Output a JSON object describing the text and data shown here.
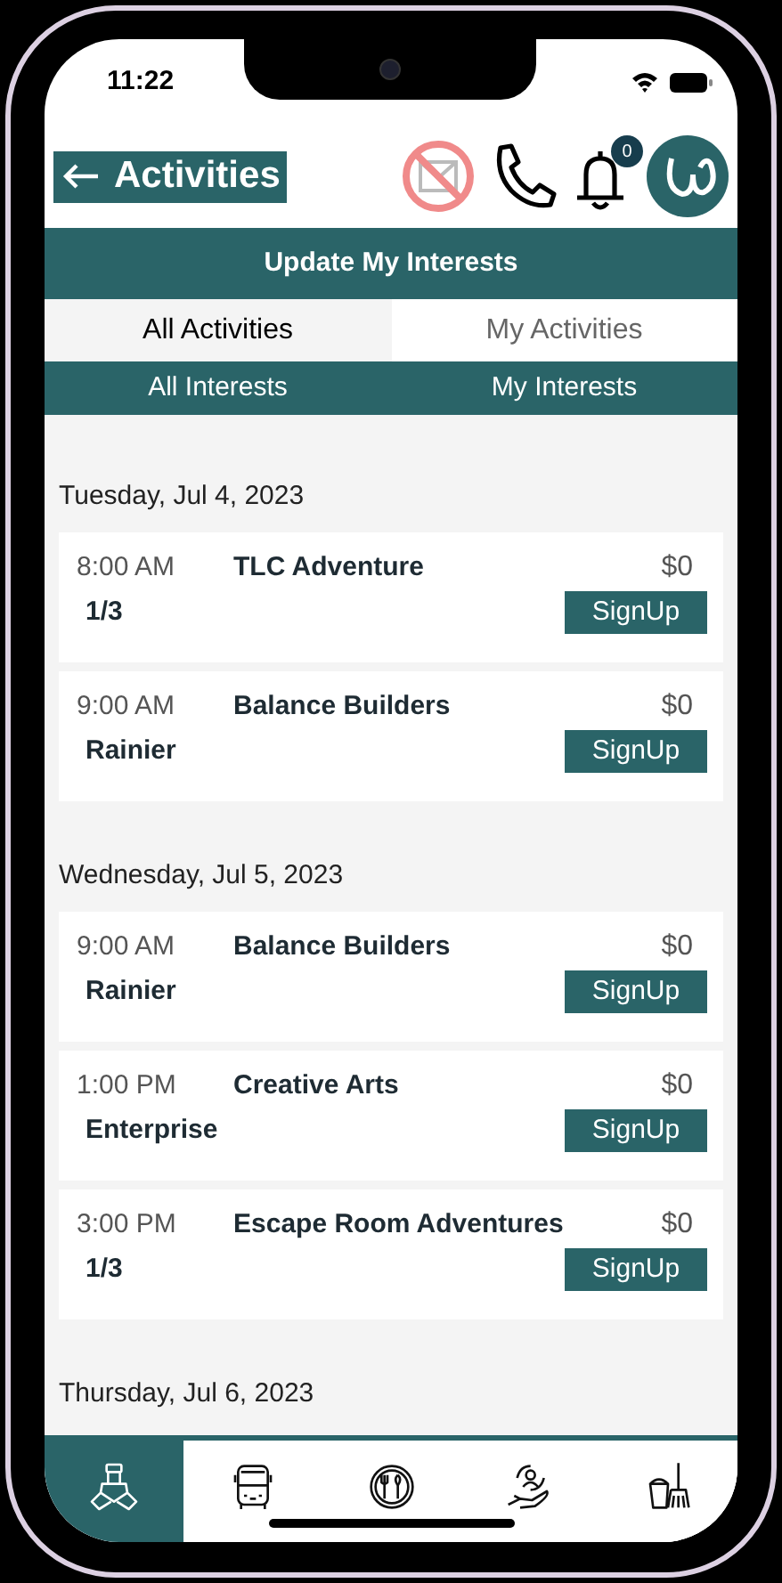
{
  "status_bar": {
    "time": "11:22"
  },
  "header": {
    "title": "Activities",
    "notification_count": "0"
  },
  "update_button": "Update My Interests",
  "tabs": [
    {
      "label": "All Activities",
      "selected": true
    },
    {
      "label": "My Activities",
      "selected": false
    }
  ],
  "interest_filters": [
    "All Interests",
    "My Interests"
  ],
  "days": [
    {
      "date": "Tuesday, Jul 4, 2023",
      "activities": [
        {
          "time": "8:00 AM",
          "title": "TLC Adventure",
          "price": "$0",
          "detail": "1/3",
          "button": "SignUp"
        },
        {
          "time": "9:00 AM",
          "title": "Balance Builders",
          "price": "$0",
          "detail": "Rainier",
          "button": "SignUp"
        }
      ]
    },
    {
      "date": "Wednesday, Jul 5, 2023",
      "activities": [
        {
          "time": "9:00 AM",
          "title": "Balance Builders",
          "price": "$0",
          "detail": "Rainier",
          "button": "SignUp"
        },
        {
          "time": "1:00 PM",
          "title": "Creative Arts",
          "price": "$0",
          "detail": "Enterprise",
          "button": "SignUp"
        },
        {
          "time": "3:00 PM",
          "title": "Escape Room Adventures",
          "price": "$0",
          "detail": "1/3",
          "button": "SignUp"
        }
      ]
    },
    {
      "date": "Thursday, Jul 6, 2023"
    }
  ],
  "bottom_nav": [
    {
      "kind": "hands",
      "selected": true
    },
    {
      "kind": "bus",
      "selected": false
    },
    {
      "kind": "dining",
      "selected": false
    },
    {
      "kind": "care",
      "selected": false
    },
    {
      "kind": "cleaning",
      "selected": false
    }
  ]
}
